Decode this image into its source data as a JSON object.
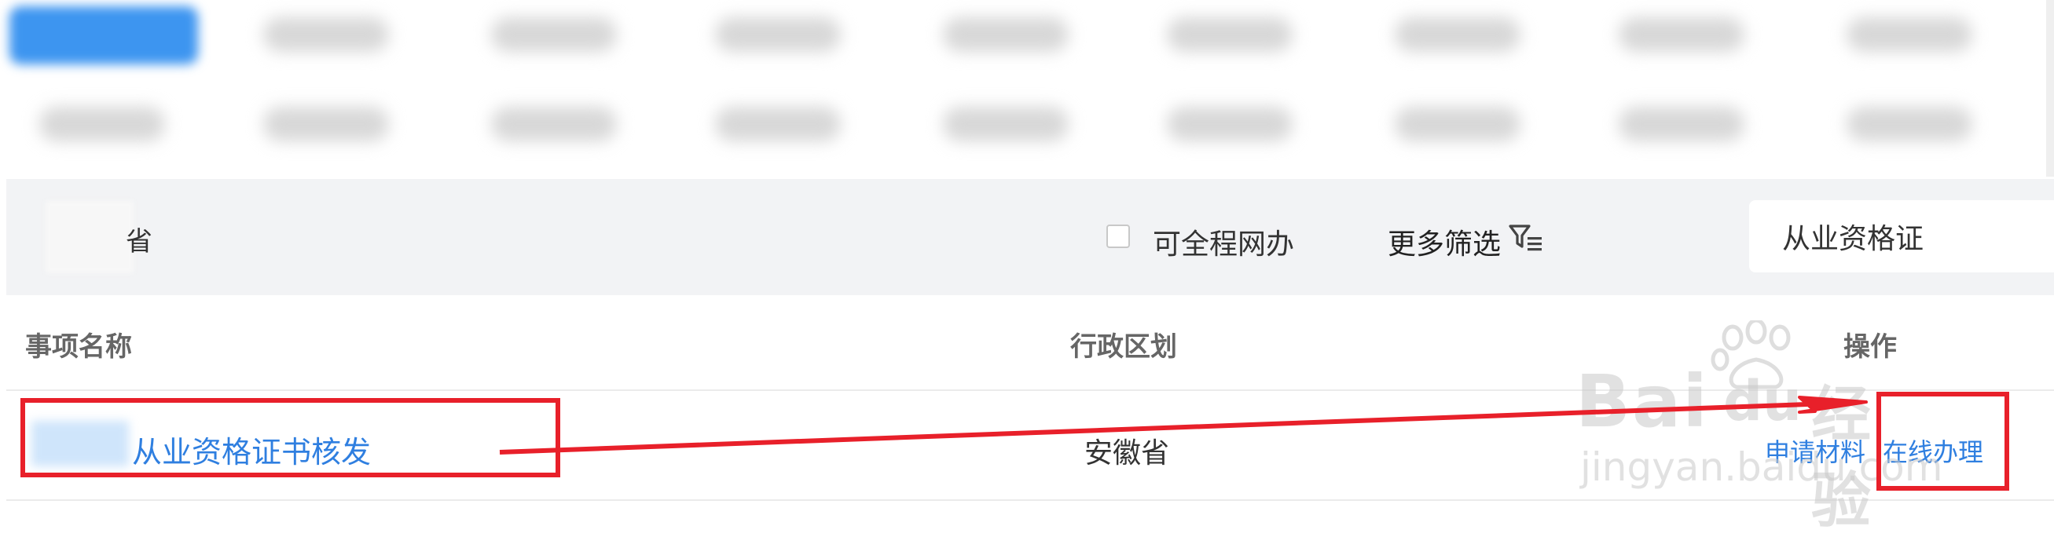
{
  "filter_bar": {
    "region_visible_tail": "省",
    "online_checkbox_label": "可全程网办",
    "online_checked": false,
    "more_filters_label": "更多筛选",
    "filter_icon": "funnel-list-icon",
    "search_value": "从业资格证"
  },
  "table": {
    "headers": {
      "name": "事项名称",
      "region": "行政区划",
      "actions": "操作"
    },
    "rows": [
      {
        "name": "从业资格证书核发",
        "region": "安徽省",
        "action_materials": "申请材料",
        "action_online": "在线办理"
      }
    ]
  },
  "watermark": {
    "brand": "Bai",
    "brand_suffix": "du",
    "cn": "经验",
    "url": "jingyan.baidu.com"
  },
  "colors": {
    "link": "#2f7fe0",
    "annotation": "#e8202a",
    "filter_bg": "#f2f3f5",
    "active_chip": "#3d95f0"
  }
}
